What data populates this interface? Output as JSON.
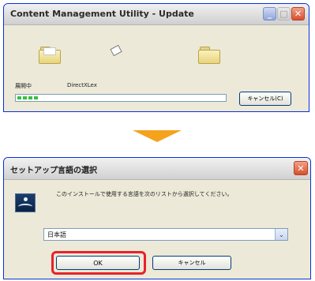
{
  "update_window": {
    "title": "Content Management Utility - Update",
    "status_label": "展開中",
    "file_name": "DirectXLex",
    "progress": 0.1,
    "cancel_label": "キャンセル(C)",
    "titlebar_buttons": {
      "minimize": "_",
      "maximize": "□",
      "close": "✕"
    }
  },
  "arrow": {
    "color": "#f5a21d"
  },
  "language_window": {
    "title": "セットアップ言語の選択",
    "close_label": "✕",
    "instruction": "このインストールで使用する言語を次のリストから選択してください。",
    "language_select": {
      "value": "日本語",
      "dropdown_glyph": "⌄"
    },
    "ok_label": "OK",
    "cancel_label": "キャンセル",
    "highlight_color": "#e8212c"
  }
}
